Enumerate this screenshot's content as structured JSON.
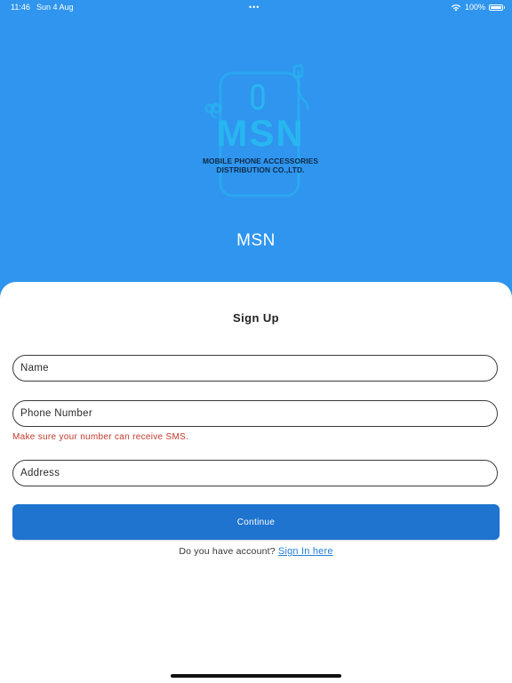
{
  "status_bar": {
    "time": "11:46",
    "date": "Sun 4 Aug",
    "battery": "100%",
    "dots": "•••"
  },
  "logo": {
    "wordmark": "MSN",
    "subtitle_line1": "MOBILE PHONE ACCESSORIES",
    "subtitle_line2": "DISTRIBUTION CO.,LTD."
  },
  "header": {
    "app_name": "MSN"
  },
  "form": {
    "title": "Sign Up",
    "name_placeholder": "Name",
    "phone_placeholder": "Phone Number",
    "phone_hint": "Make sure your number can receive SMS.",
    "address_placeholder": "Address",
    "continue_label": "Continue",
    "account_prompt": "Do you have account?",
    "signin_link": "Sign In here"
  },
  "colors": {
    "background_blue": "#2f95ef",
    "button_blue": "#1e74cf",
    "link_blue": "#1f7ed8",
    "hint_red": "#c0392b",
    "logo_cyan": "#28b6f0"
  }
}
